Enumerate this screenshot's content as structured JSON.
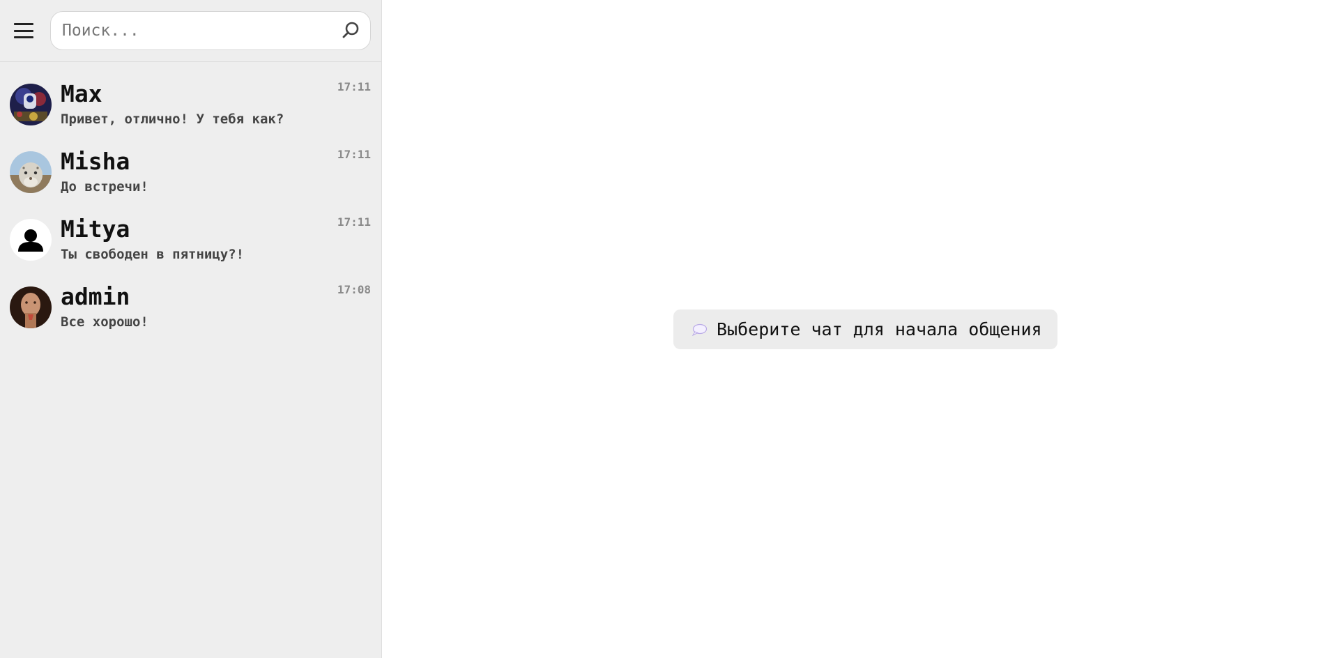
{
  "search": {
    "placeholder": "Поиск..."
  },
  "icons": {
    "menu": "menu-icon",
    "search": "search-icon",
    "speech_bubble": "speech-bubble-icon"
  },
  "colors": {
    "sidebar_bg": "#eeeeee",
    "main_bg": "#ffffff",
    "badge_bg": "#ececec",
    "time": "#8a8a8a"
  },
  "chats": [
    {
      "name": "Max",
      "preview": "Привет, отлично! У тебя как?",
      "time": "17:11"
    },
    {
      "name": "Misha",
      "preview": "До встречи!",
      "time": "17:11"
    },
    {
      "name": "Mitya",
      "preview": "Ты свободен в пятницу?!",
      "time": "17:11"
    },
    {
      "name": "admin",
      "preview": "Все хорошо!",
      "time": "17:08"
    }
  ],
  "main": {
    "empty_message": "Выберите чат для начала общения"
  }
}
